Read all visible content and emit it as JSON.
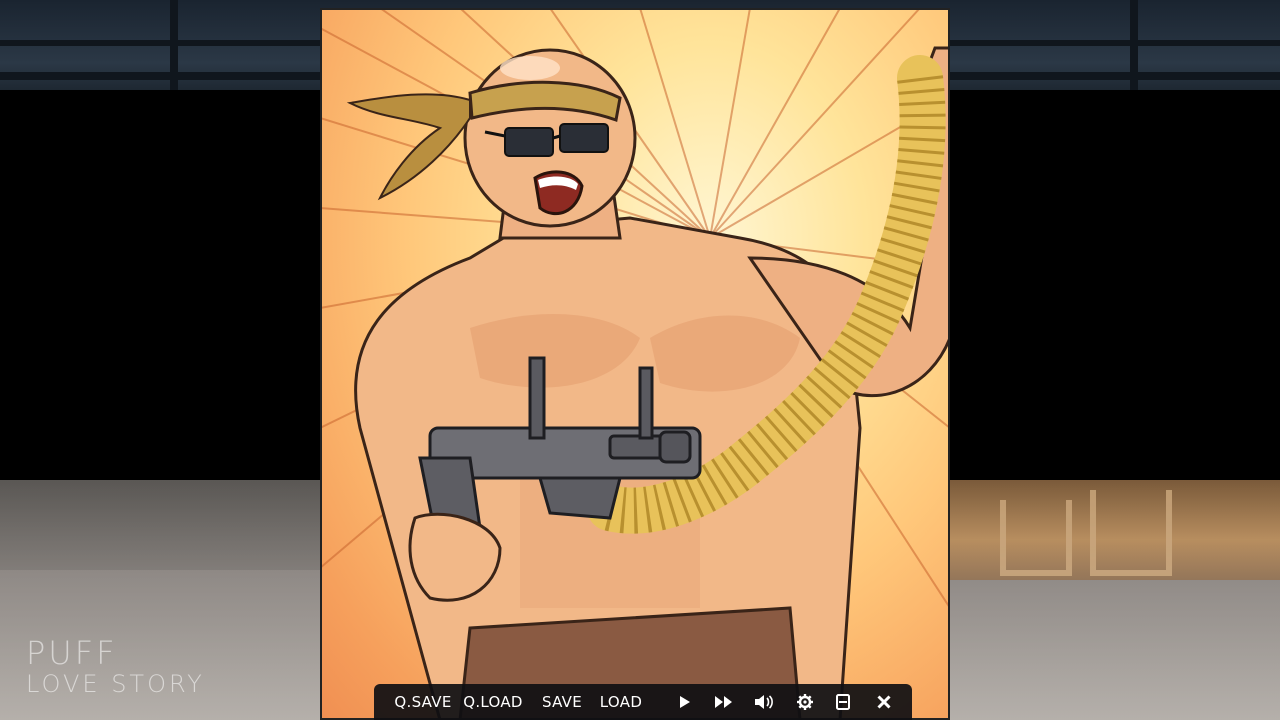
{
  "logo": {
    "line1": "PUFF",
    "line2": "LOVE STORY"
  },
  "quick_menu": {
    "qsave": "Q.SAVE",
    "qload": "Q.LOAD",
    "save": "SAVE",
    "load": "LOAD",
    "icons": [
      "play-icon",
      "fast-forward-icon",
      "volume-icon",
      "gear-icon",
      "menu-icon",
      "close-icon"
    ]
  },
  "colors": {
    "panel_center": "#fff6d2",
    "panel_edge": "#f08f52",
    "skin": "#f2b888",
    "headband": "#c7a14e",
    "gun": "#6e6e74",
    "ammo_belt": "#e8c25a",
    "menu_bg": "#0f0f12"
  }
}
